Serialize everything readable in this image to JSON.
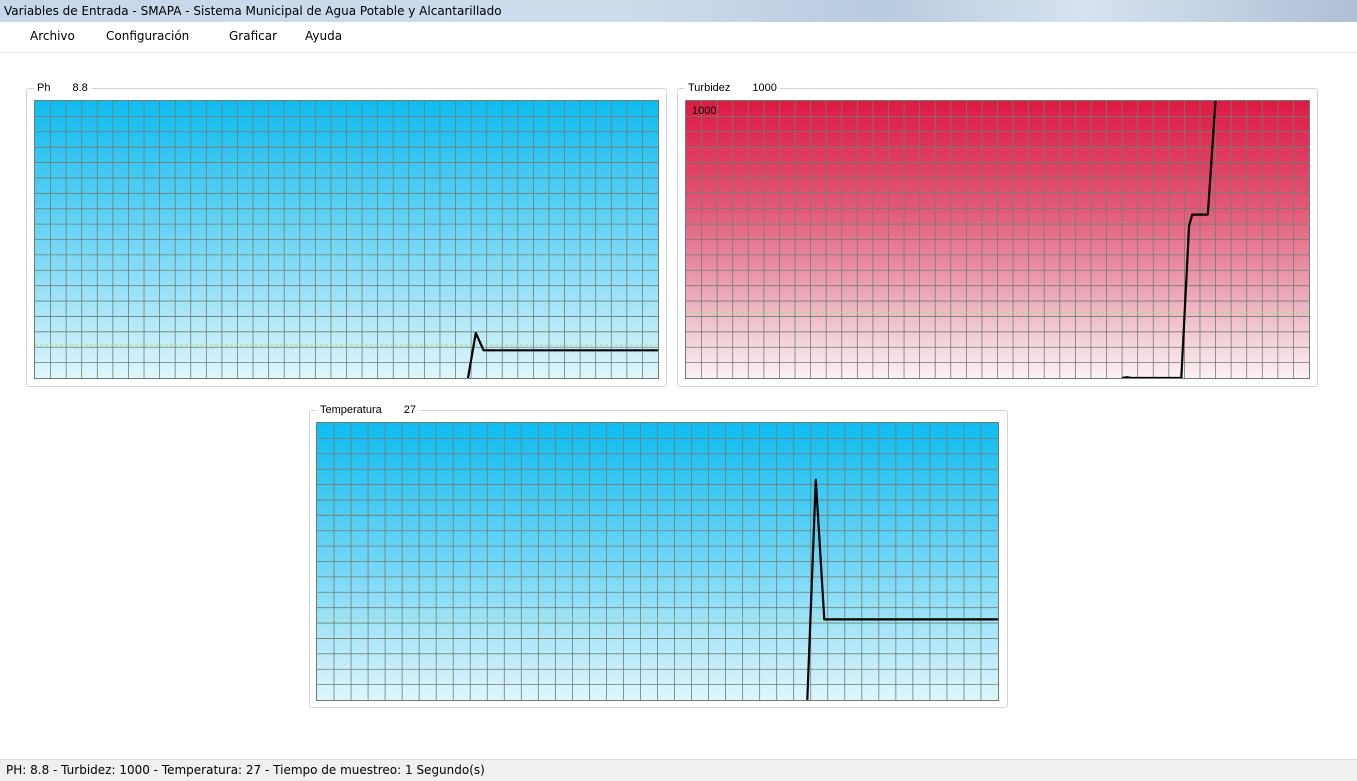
{
  "window": {
    "title": "Variables de Entrada - SMAPA - Sistema Municipal de Agua Potable y Alcantarillado"
  },
  "menu": {
    "items": [
      "Archivo",
      "Configuración",
      "Graficar",
      "Ayuda"
    ]
  },
  "panels": {
    "ph": {
      "label": "Ph",
      "value": "8.8"
    },
    "turbidez": {
      "label": "Turbidez",
      "value": "1000",
      "max_label": "1000"
    },
    "temperatura": {
      "label": "Temperatura",
      "value": "27"
    }
  },
  "colors": {
    "ph_plot_top": "#10bcf0",
    "turbidez_plot_top": "#dc1a45",
    "temperatura_plot_top": "#10bcf0",
    "grid_line": "#6f7f6f",
    "reference_line": "#9be08a",
    "trace": "#000000"
  },
  "status": {
    "text": "PH: 8.8   - Turbidez: 1000   - Temperatura: 27   - Tiempo de muestreo: 1 Segundo(s)"
  },
  "chart_data": [
    {
      "type": "line",
      "name": "Ph",
      "xlim": [
        0,
        40
      ],
      "ylim": [
        0,
        16
      ],
      "reference_level": 1.9,
      "x": [
        27.8,
        28.3,
        28.8,
        40
      ],
      "y": [
        0,
        2.6,
        1.6,
        1.6
      ]
    },
    {
      "type": "line",
      "name": "Turbidez",
      "xlim": [
        0,
        40
      ],
      "ylim": [
        0,
        1000
      ],
      "reference_level": 235,
      "x": [
        28.0,
        28.3,
        28.6,
        31.8,
        32.3,
        32.5,
        32.8,
        33.5,
        34.0
      ],
      "y": [
        0,
        3,
        0,
        0,
        550,
        590,
        590,
        590,
        1000
      ]
    },
    {
      "type": "line",
      "name": "Temperatura",
      "xlim": [
        0,
        40
      ],
      "ylim": [
        0,
        22
      ],
      "reference_level": 6.5,
      "x": [
        28.8,
        29.3,
        29.8,
        30.5,
        31.5,
        32.5,
        33.5,
        34.5,
        35.5,
        36.5,
        37.5,
        38.5,
        39.5,
        40
      ],
      "y": [
        0,
        17.5,
        6.4,
        6.4,
        6.4,
        6.4,
        6.4,
        6.4,
        6.4,
        6.4,
        6.4,
        6.4,
        6.4,
        6.4
      ]
    }
  ]
}
